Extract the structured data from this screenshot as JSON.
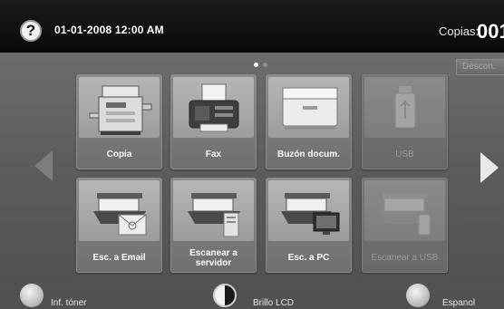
{
  "header": {
    "help_icon_glyph": "?",
    "datetime": "01-01-2008 12:00 AM",
    "copies_label": "Copias:",
    "copies_value": "001"
  },
  "page_indicator": {
    "count": 2,
    "active_index": 0
  },
  "disconnect_label": "Descon.",
  "colors": {
    "accent_text": "#ffffff",
    "disabled_text": "#9a9a9a",
    "panel_bg": "#5c5c5c",
    "topbar_bg": "#0e0e0e"
  },
  "tiles": [
    {
      "label": "Copia",
      "icon": "copier-icon",
      "enabled": true
    },
    {
      "label": "Fax",
      "icon": "fax-icon",
      "enabled": true
    },
    {
      "label": "Buzón docum.",
      "icon": "document-box-icon",
      "enabled": true
    },
    {
      "label": "USB",
      "icon": "usb-icon",
      "enabled": false
    },
    {
      "label": "Esc. a Email",
      "icon": "scan-to-email-icon",
      "enabled": true
    },
    {
      "label": "Escanear a servidor",
      "icon": "scan-to-server-icon",
      "enabled": true
    },
    {
      "label": "Esc. a PC",
      "icon": "scan-to-pc-icon",
      "enabled": true
    },
    {
      "label": "Escanear a USB",
      "icon": "scan-to-usb-icon",
      "enabled": false
    }
  ],
  "footer": {
    "toner_label": "Inf. tóner",
    "brightness_label": "Brillo LCD",
    "language_label": "Espanol"
  }
}
